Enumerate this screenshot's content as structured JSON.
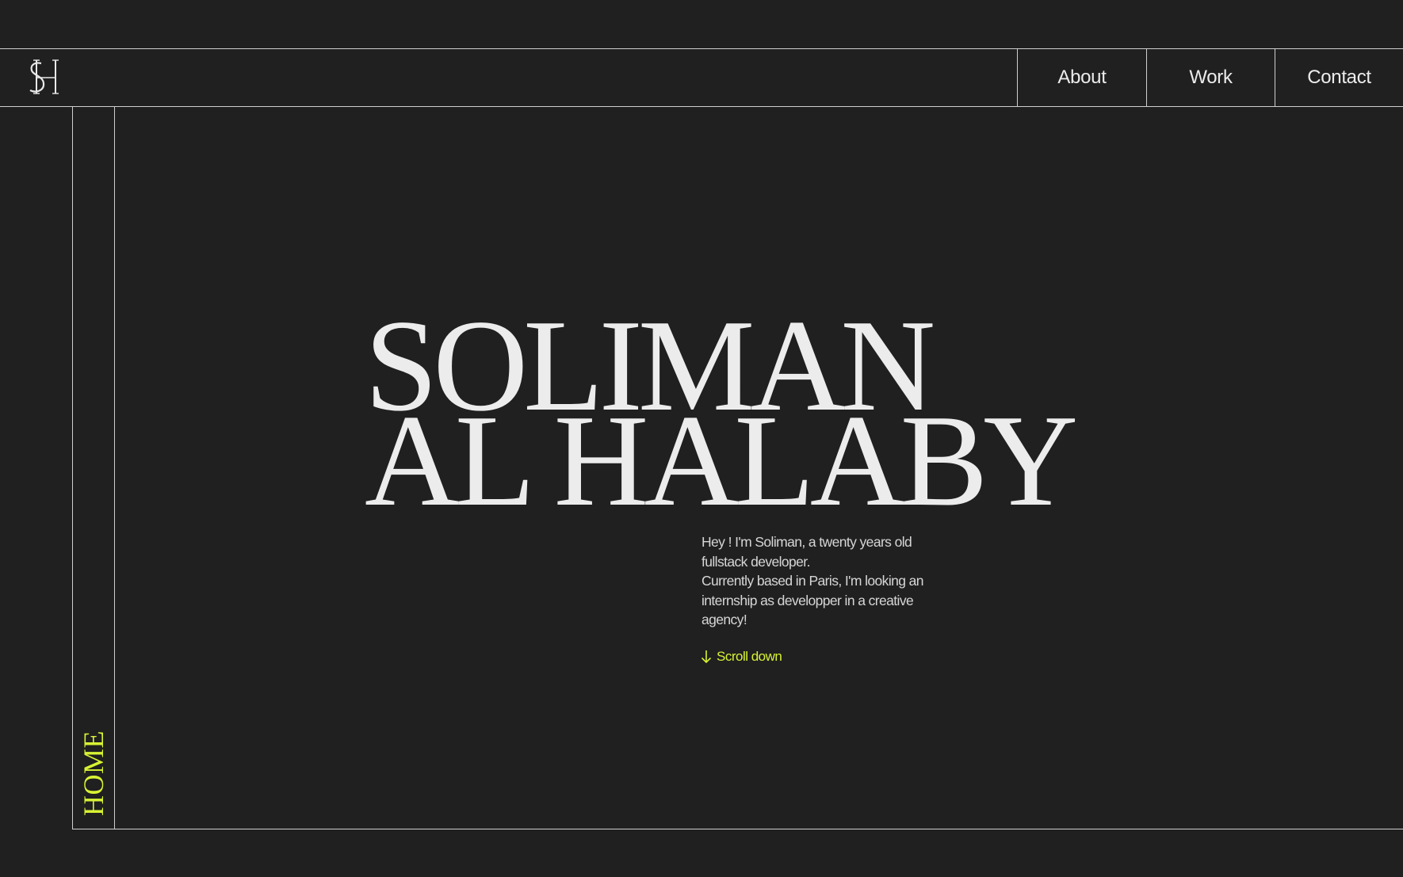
{
  "brand": {
    "logo_icon": "sh-monogram-logo"
  },
  "nav": {
    "items": [
      {
        "label": "About"
      },
      {
        "label": "Work"
      },
      {
        "label": "Contact"
      }
    ]
  },
  "sidebar": {
    "section_label": "HOME"
  },
  "hero": {
    "name_line_1": "SOLIMAN",
    "name_line_2": "AL HALABY",
    "intro_line_1": "Hey ! I'm Soliman, a twenty years old fullstack developer.",
    "intro_line_2": "Currently based in Paris, I'm looking an internship as developper in a creative agency!",
    "scroll_label": "Scroll down",
    "scroll_icon": "arrow-down-icon"
  },
  "colors": {
    "background": "#202020",
    "text": "#ececec",
    "accent": "#d8f233",
    "lines": "#cfcfcf"
  }
}
